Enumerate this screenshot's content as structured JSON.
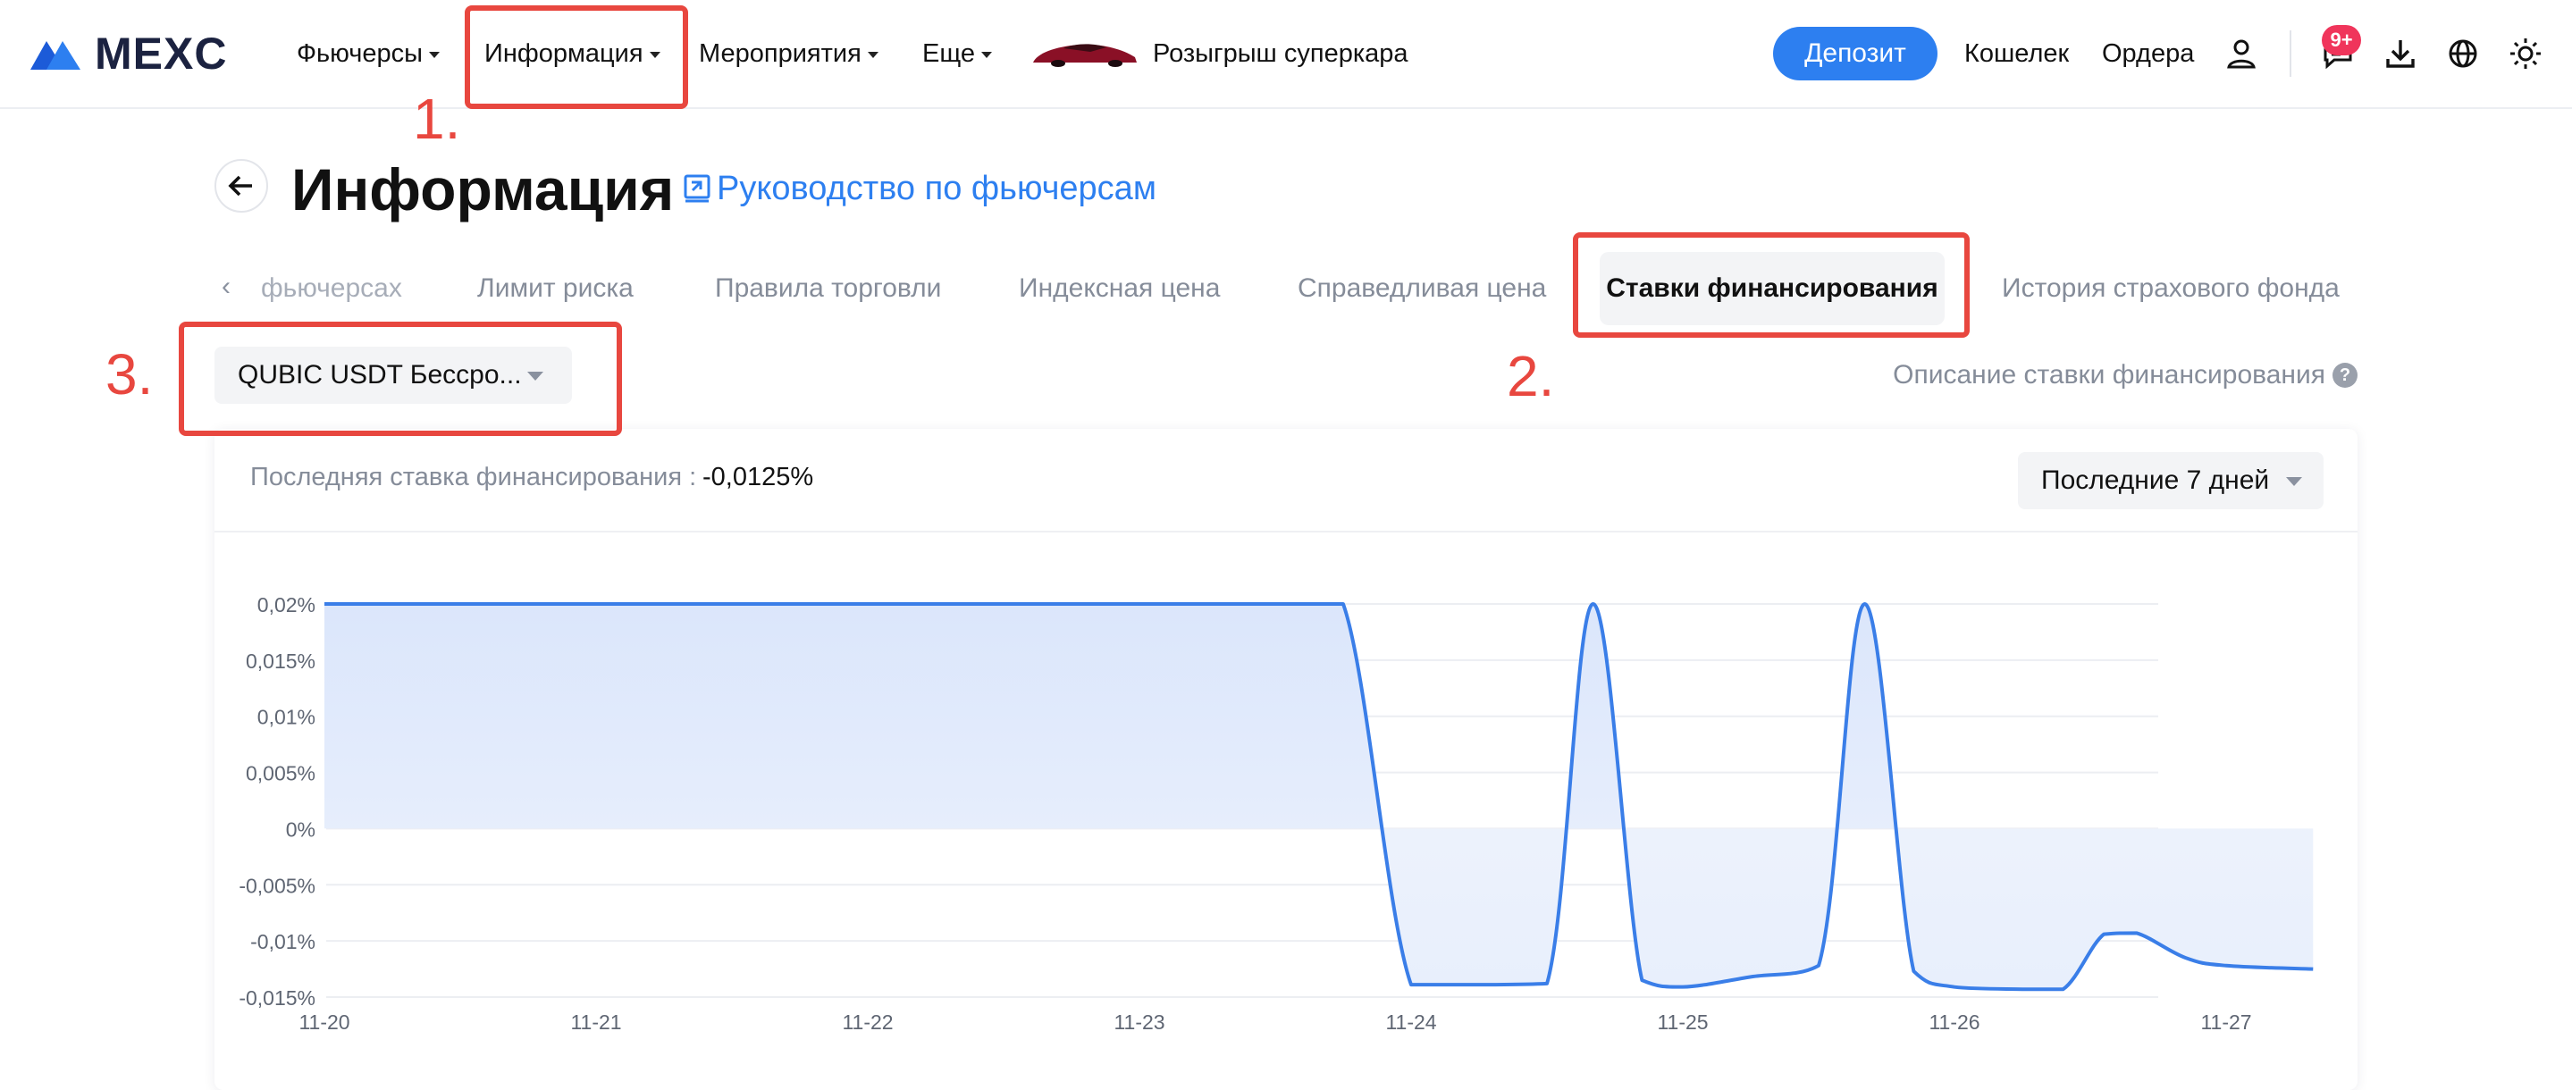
{
  "brand": {
    "name": "MEXC"
  },
  "nav": {
    "items": [
      {
        "label": "Фьючерсы",
        "has_caret": true
      },
      {
        "label": "Информация",
        "has_caret": true
      },
      {
        "label": "Мероприятия",
        "has_caret": true
      },
      {
        "label": "Еще",
        "has_caret": true
      }
    ],
    "promo_label": "Розыгрыш суперкара",
    "deposit_label": "Депозит",
    "wallet_label": "Кошелек",
    "orders_label": "Ордера",
    "notifications_badge": "9+",
    "icons": [
      "user-icon",
      "chat-icon",
      "download-icon",
      "globe-icon",
      "sun-icon"
    ]
  },
  "header": {
    "title": "Информация",
    "guide_link": "Руководство по фьючерсам"
  },
  "tabs": [
    {
      "label": "фьючерсах",
      "active": false
    },
    {
      "label": "Лимит риска",
      "active": false
    },
    {
      "label": "Правила торговли",
      "active": false
    },
    {
      "label": "Индексная цена",
      "active": false
    },
    {
      "label": "Справедливая цена",
      "active": false
    },
    {
      "label": "Ставки финансирования",
      "active": true
    },
    {
      "label": "История страхового фонда",
      "active": false
    }
  ],
  "symbol_select": {
    "value": "QUBIC USDT Бессро..."
  },
  "funding_description_link": "Описание ставки финансирования",
  "card": {
    "last_rate_label": "Последняя ставка финансирования :",
    "last_rate_value": "-0,0125%",
    "period_select": "Последние 7 дней"
  },
  "annotations": [
    "1.",
    "2.",
    "3."
  ],
  "colors": {
    "accent": "#2d7ff0",
    "annotation": "#e8473f",
    "line": "#3a7ee8"
  },
  "chart_data": {
    "type": "area",
    "title": "",
    "xlabel": "",
    "ylabel": "",
    "ylim": [
      -0.015,
      0.02
    ],
    "y_ticks": [
      0.02,
      0.015,
      0.01,
      0.005,
      0,
      -0.005,
      -0.01,
      -0.015
    ],
    "y_tick_labels": [
      "0,02%",
      "0,015%",
      "0,01%",
      "0,005%",
      "0%",
      "-0,005%",
      "-0,01%",
      "-0,015%"
    ],
    "x_tick_labels": [
      "11-20",
      "11-21",
      "11-22",
      "11-23",
      "11-24",
      "11-25",
      "11-26",
      "11-27"
    ],
    "grid": true,
    "series": [
      {
        "x": [
          0,
          0.5,
          1,
          1.5,
          2,
          2.5,
          3,
          3.5,
          3.75,
          4,
          4.25,
          4.5,
          4.67,
          4.85,
          5,
          5.25,
          5.5,
          5.67,
          5.85,
          6,
          6.25,
          6.4,
          6.55,
          6.67,
          6.85,
          7,
          7.32
        ],
        "y": [
          0.02,
          0.02,
          0.02,
          0.02,
          0.02,
          0.02,
          0.02,
          0.02,
          0.02,
          -0.0139,
          -0.0139,
          -0.0138,
          0.02,
          -0.0135,
          -0.0141,
          -0.0132,
          -0.0122,
          0.02,
          -0.0127,
          -0.0141,
          -0.0143,
          -0.0143,
          -0.0094,
          -0.0093,
          -0.0115,
          -0.0122,
          -0.0125
        ]
      }
    ]
  }
}
